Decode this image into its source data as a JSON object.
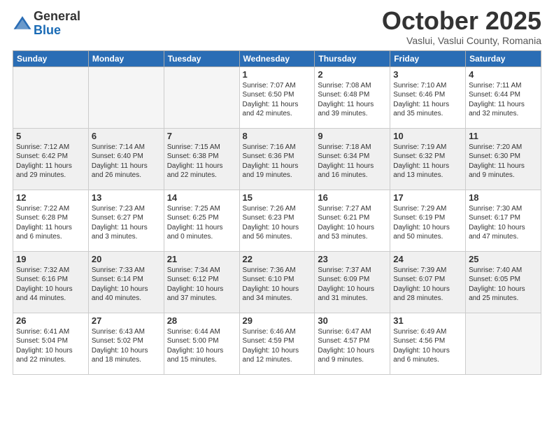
{
  "header": {
    "logo_general": "General",
    "logo_blue": "Blue",
    "month_title": "October 2025",
    "location": "Vaslui, Vaslui County, Romania"
  },
  "weekdays": [
    "Sunday",
    "Monday",
    "Tuesday",
    "Wednesday",
    "Thursday",
    "Friday",
    "Saturday"
  ],
  "weeks": [
    [
      {
        "day": "",
        "info": ""
      },
      {
        "day": "",
        "info": ""
      },
      {
        "day": "",
        "info": ""
      },
      {
        "day": "1",
        "info": "Sunrise: 7:07 AM\nSunset: 6:50 PM\nDaylight: 11 hours and 42 minutes."
      },
      {
        "day": "2",
        "info": "Sunrise: 7:08 AM\nSunset: 6:48 PM\nDaylight: 11 hours and 39 minutes."
      },
      {
        "day": "3",
        "info": "Sunrise: 7:10 AM\nSunset: 6:46 PM\nDaylight: 11 hours and 35 minutes."
      },
      {
        "day": "4",
        "info": "Sunrise: 7:11 AM\nSunset: 6:44 PM\nDaylight: 11 hours and 32 minutes."
      }
    ],
    [
      {
        "day": "5",
        "info": "Sunrise: 7:12 AM\nSunset: 6:42 PM\nDaylight: 11 hours and 29 minutes."
      },
      {
        "day": "6",
        "info": "Sunrise: 7:14 AM\nSunset: 6:40 PM\nDaylight: 11 hours and 26 minutes."
      },
      {
        "day": "7",
        "info": "Sunrise: 7:15 AM\nSunset: 6:38 PM\nDaylight: 11 hours and 22 minutes."
      },
      {
        "day": "8",
        "info": "Sunrise: 7:16 AM\nSunset: 6:36 PM\nDaylight: 11 hours and 19 minutes."
      },
      {
        "day": "9",
        "info": "Sunrise: 7:18 AM\nSunset: 6:34 PM\nDaylight: 11 hours and 16 minutes."
      },
      {
        "day": "10",
        "info": "Sunrise: 7:19 AM\nSunset: 6:32 PM\nDaylight: 11 hours and 13 minutes."
      },
      {
        "day": "11",
        "info": "Sunrise: 7:20 AM\nSunset: 6:30 PM\nDaylight: 11 hours and 9 minutes."
      }
    ],
    [
      {
        "day": "12",
        "info": "Sunrise: 7:22 AM\nSunset: 6:28 PM\nDaylight: 11 hours and 6 minutes."
      },
      {
        "day": "13",
        "info": "Sunrise: 7:23 AM\nSunset: 6:27 PM\nDaylight: 11 hours and 3 minutes."
      },
      {
        "day": "14",
        "info": "Sunrise: 7:25 AM\nSunset: 6:25 PM\nDaylight: 11 hours and 0 minutes."
      },
      {
        "day": "15",
        "info": "Sunrise: 7:26 AM\nSunset: 6:23 PM\nDaylight: 10 hours and 56 minutes."
      },
      {
        "day": "16",
        "info": "Sunrise: 7:27 AM\nSunset: 6:21 PM\nDaylight: 10 hours and 53 minutes."
      },
      {
        "day": "17",
        "info": "Sunrise: 7:29 AM\nSunset: 6:19 PM\nDaylight: 10 hours and 50 minutes."
      },
      {
        "day": "18",
        "info": "Sunrise: 7:30 AM\nSunset: 6:17 PM\nDaylight: 10 hours and 47 minutes."
      }
    ],
    [
      {
        "day": "19",
        "info": "Sunrise: 7:32 AM\nSunset: 6:16 PM\nDaylight: 10 hours and 44 minutes."
      },
      {
        "day": "20",
        "info": "Sunrise: 7:33 AM\nSunset: 6:14 PM\nDaylight: 10 hours and 40 minutes."
      },
      {
        "day": "21",
        "info": "Sunrise: 7:34 AM\nSunset: 6:12 PM\nDaylight: 10 hours and 37 minutes."
      },
      {
        "day": "22",
        "info": "Sunrise: 7:36 AM\nSunset: 6:10 PM\nDaylight: 10 hours and 34 minutes."
      },
      {
        "day": "23",
        "info": "Sunrise: 7:37 AM\nSunset: 6:09 PM\nDaylight: 10 hours and 31 minutes."
      },
      {
        "day": "24",
        "info": "Sunrise: 7:39 AM\nSunset: 6:07 PM\nDaylight: 10 hours and 28 minutes."
      },
      {
        "day": "25",
        "info": "Sunrise: 7:40 AM\nSunset: 6:05 PM\nDaylight: 10 hours and 25 minutes."
      }
    ],
    [
      {
        "day": "26",
        "info": "Sunrise: 6:41 AM\nSunset: 5:04 PM\nDaylight: 10 hours and 22 minutes."
      },
      {
        "day": "27",
        "info": "Sunrise: 6:43 AM\nSunset: 5:02 PM\nDaylight: 10 hours and 18 minutes."
      },
      {
        "day": "28",
        "info": "Sunrise: 6:44 AM\nSunset: 5:00 PM\nDaylight: 10 hours and 15 minutes."
      },
      {
        "day": "29",
        "info": "Sunrise: 6:46 AM\nSunset: 4:59 PM\nDaylight: 10 hours and 12 minutes."
      },
      {
        "day": "30",
        "info": "Sunrise: 6:47 AM\nSunset: 4:57 PM\nDaylight: 10 hours and 9 minutes."
      },
      {
        "day": "31",
        "info": "Sunrise: 6:49 AM\nSunset: 4:56 PM\nDaylight: 10 hours and 6 minutes."
      },
      {
        "day": "",
        "info": ""
      }
    ]
  ]
}
